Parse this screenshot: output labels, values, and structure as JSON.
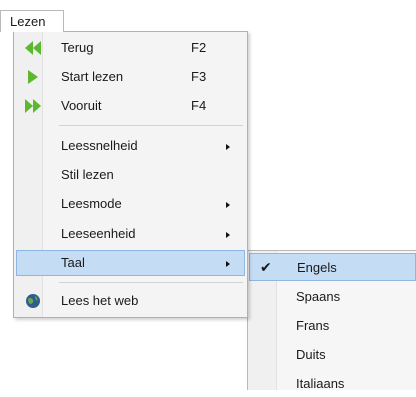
{
  "menubar": {
    "tab_label": "Lezen"
  },
  "menu": {
    "items": [
      {
        "label": "Terug",
        "shortcut": "F2",
        "icon": "rewind-icon"
      },
      {
        "label": "Start lezen",
        "shortcut": "F3",
        "icon": "play-icon"
      },
      {
        "label": "Vooruit",
        "shortcut": "F4",
        "icon": "fast-forward-icon"
      },
      {
        "label": "Leessnelheid",
        "has_submenu": true
      },
      {
        "label": "Stil lezen"
      },
      {
        "label": "Leesmode",
        "has_submenu": true
      },
      {
        "label": "Leeseenheid",
        "has_submenu": true
      },
      {
        "label": "Taal",
        "has_submenu": true,
        "highlighted": true
      },
      {
        "label": "Lees het web",
        "icon": "globe-icon"
      }
    ]
  },
  "submenu": {
    "items": [
      {
        "label": "Engels",
        "checked": true,
        "highlighted": true
      },
      {
        "label": "Spaans"
      },
      {
        "label": "Frans"
      },
      {
        "label": "Duits"
      },
      {
        "label": "Italiaans"
      }
    ]
  },
  "colors": {
    "highlight": "#c5dcf5",
    "highlight_border": "#8fb6e2",
    "icon_green": "#5cb82f",
    "globe_blue": "#2f5e8e"
  }
}
